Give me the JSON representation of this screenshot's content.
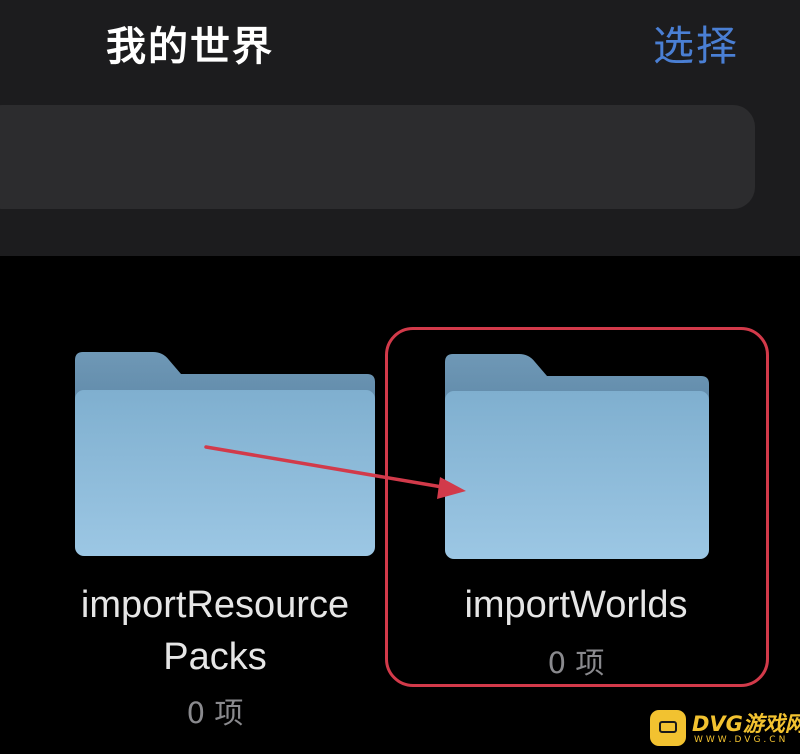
{
  "nav": {
    "title": "我的世界",
    "select_label": "选择"
  },
  "search": {
    "placeholder": ""
  },
  "folders": [
    {
      "name_line1": "importResource",
      "name_line2": "Packs",
      "count": "0 项",
      "icon": "folder-icon"
    },
    {
      "name_line1": "importWorlds",
      "count": "0 项",
      "icon": "folder-icon",
      "highlighted": true
    }
  ],
  "annotation": {
    "arrow_color": "#d23a4a",
    "highlight_color": "#d23a4a"
  },
  "watermark": {
    "brand": "DVG游戏网",
    "site": "WWW.DVG.CN"
  },
  "colors": {
    "accent": "#4a7fd4",
    "background": "#000000",
    "top_bar": "#1c1c1e",
    "search_field": "#2c2c2e",
    "folder_front": "#8fbedc",
    "folder_back": "#6f98b6"
  }
}
